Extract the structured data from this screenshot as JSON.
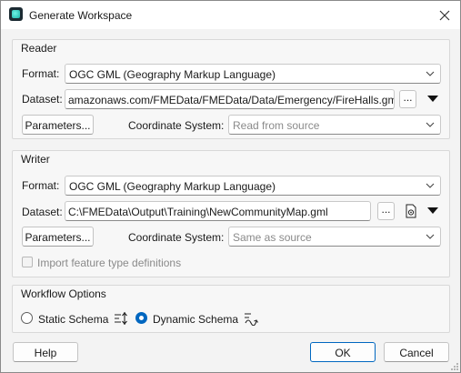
{
  "window": {
    "title": "Generate Workspace",
    "icon": "fme-workbench-icon"
  },
  "reader": {
    "group_title": "Reader",
    "format_label": "Format:",
    "format_value": "OGC GML (Geography Markup Language)",
    "dataset_label": "Dataset:",
    "dataset_value": "amazonaws.com/FMEData/FMEData/Data/Emergency/FireHalls.gml",
    "browse_label": "...",
    "parameters_label": "Parameters...",
    "coord_label": "Coordinate System:",
    "coord_value": "Read from source"
  },
  "writer": {
    "group_title": "Writer",
    "format_label": "Format:",
    "format_value": "OGC GML (Geography Markup Language)",
    "dataset_label": "Dataset:",
    "dataset_value": "C:\\FMEData\\Output\\Training\\NewCommunityMap.gml",
    "browse_label": "...",
    "parameters_label": "Parameters...",
    "coord_label": "Coordinate System:",
    "coord_value": "Same as source",
    "import_label": "Import feature type definitions",
    "import_checked": false
  },
  "workflow": {
    "group_title": "Workflow Options",
    "static_label": "Static Schema",
    "dynamic_label": "Dynamic Schema",
    "selected": "Dynamic Schema"
  },
  "footer": {
    "help_label": "Help",
    "ok_label": "OK",
    "cancel_label": "Cancel"
  },
  "colors": {
    "accent": "#0067c0",
    "dialog_bg": "#f3f3f3"
  }
}
